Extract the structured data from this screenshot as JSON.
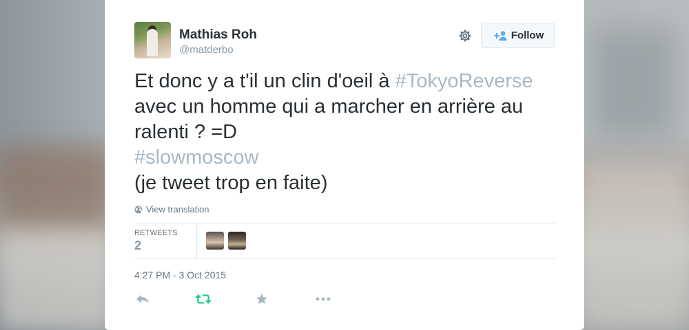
{
  "user": {
    "name": "Mathias Roh",
    "handle": "@matderbo"
  },
  "header": {
    "follow_label": "Follow",
    "settings_icon": "gear-icon",
    "follow_icon": "add-user-icon"
  },
  "tweet": {
    "lines": [
      {
        "text": "Et donc y a t'il un clin d'oeil à ",
        "hashtag": "#TokyoReverse"
      },
      {
        "text": "avec un homme qui a marcher en arrière au",
        "hashtag": ""
      },
      {
        "text": "ralenti ? =D",
        "hashtag": ""
      },
      {
        "text": "",
        "hashtag": "#slowmoscow"
      },
      {
        "text": "(je tweet trop en faite)",
        "hashtag": ""
      }
    ],
    "translate_label": "View translation",
    "translate_icon": "globe-icon"
  },
  "stats": {
    "retweets_label": "RETWEETS",
    "retweets_count": "2"
  },
  "timestamp": "4:27 PM - 3 Oct 2015",
  "actions": {
    "reply_icon": "reply-icon",
    "retweet_icon": "retweet-icon",
    "favorite_icon": "star-icon",
    "more_icon": "more-icon"
  },
  "colors": {
    "text": "#292f33",
    "secondary": "#8899a6",
    "hashtag": "#aab8c2",
    "retweet_green": "#19cf86",
    "follow_blue": "#55acee"
  }
}
